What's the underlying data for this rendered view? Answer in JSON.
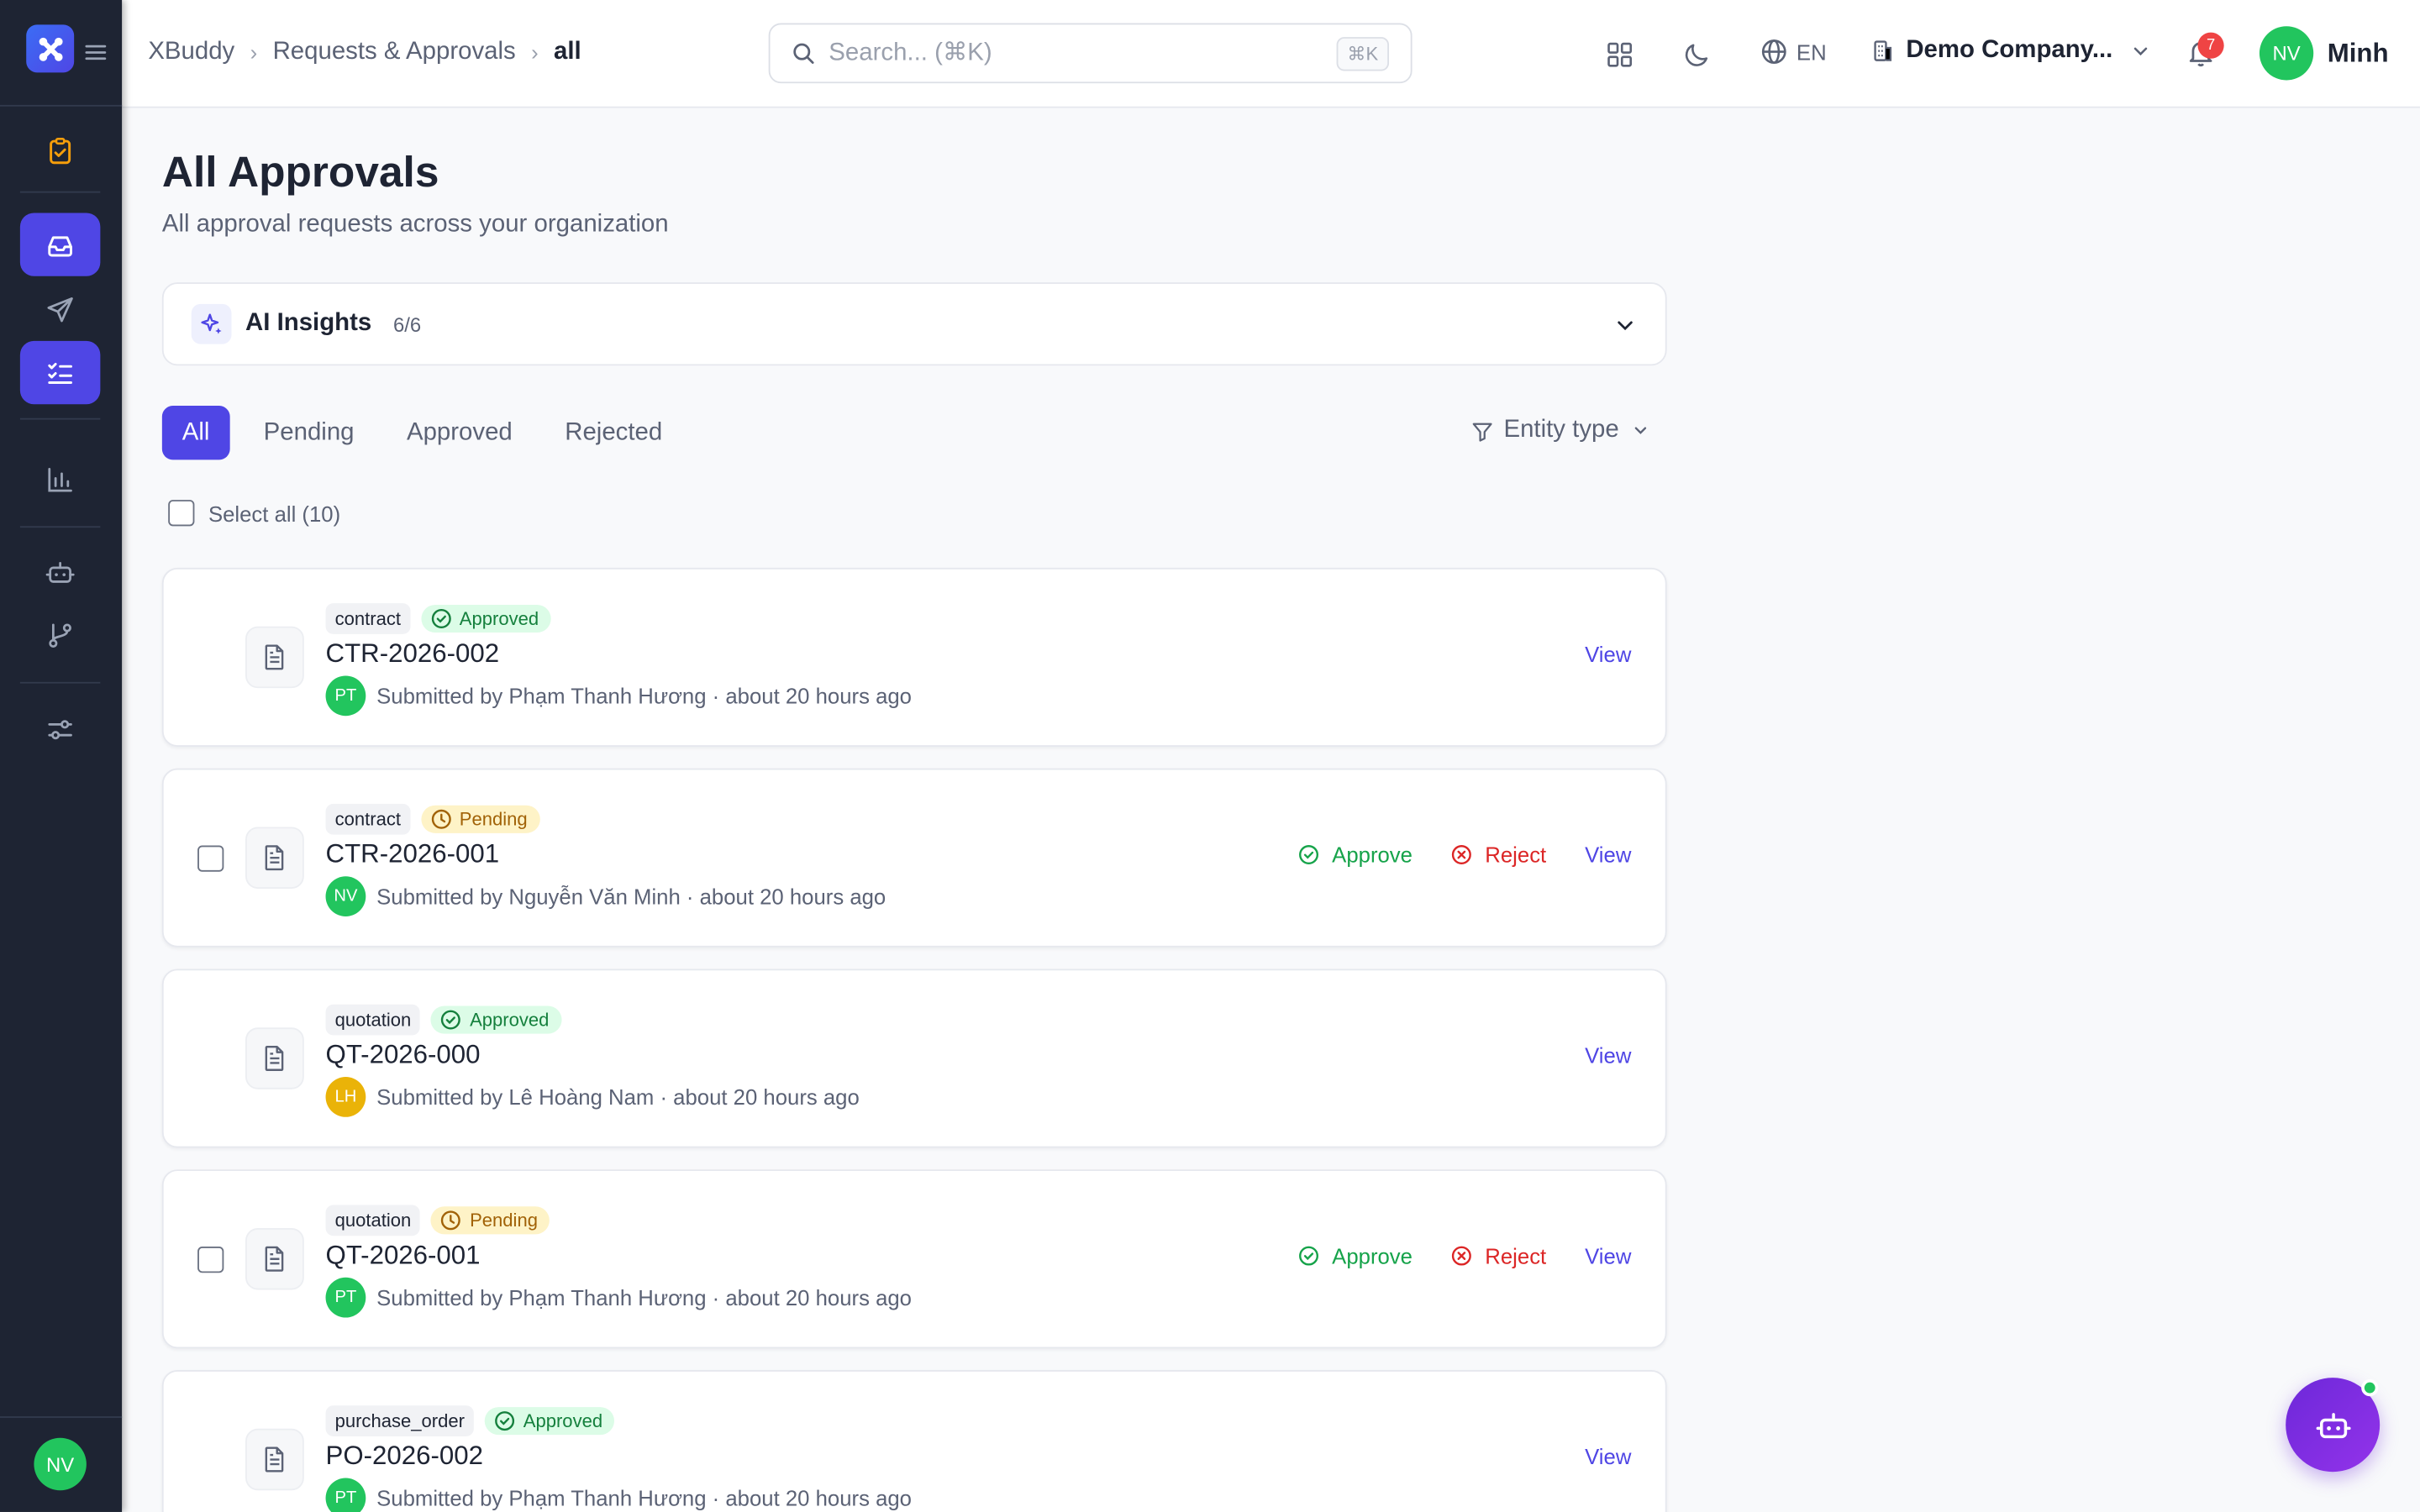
{
  "sidebar": {
    "avatar_initials": "NV"
  },
  "header": {
    "breadcrumb": [
      "XBuddy",
      "Requests & Approvals",
      "all"
    ],
    "search_placeholder": "Search... (⌘K)",
    "search_shortcut": "⌘K",
    "language": "EN",
    "company": "Demo Company...",
    "notification_count": "7",
    "user_initials": "NV",
    "user_name": "Minh"
  },
  "page": {
    "title": "All Approvals",
    "subtitle": "All approval requests across your organization"
  },
  "insights": {
    "title": "AI Insights",
    "count": "6/6"
  },
  "tabs": [
    {
      "label": "All",
      "active": true
    },
    {
      "label": "Pending",
      "active": false
    },
    {
      "label": "Approved",
      "active": false
    },
    {
      "label": "Rejected",
      "active": false
    }
  ],
  "filter_label": "Entity type",
  "select_all_label": "Select all (10)",
  "actions": {
    "approve": "Approve",
    "reject": "Reject",
    "view": "View"
  },
  "requests": [
    {
      "type": "contract",
      "status": "Approved",
      "code": "CTR-2026-002",
      "initials": "PT",
      "avatar_color": "#22c55e",
      "submitted": "Submitted by Phạm Thanh Hương · about 20 hours ago"
    },
    {
      "type": "contract",
      "status": "Pending",
      "code": "CTR-2026-001",
      "initials": "NV",
      "avatar_color": "#22c55e",
      "submitted": "Submitted by Nguyễn Văn Minh · about 20 hours ago"
    },
    {
      "type": "quotation",
      "status": "Approved",
      "code": "QT-2026-000",
      "initials": "LH",
      "avatar_color": "#eab308",
      "submitted": "Submitted by Lê Hoàng Nam · about 20 hours ago"
    },
    {
      "type": "quotation",
      "status": "Pending",
      "code": "QT-2026-001",
      "initials": "PT",
      "avatar_color": "#22c55e",
      "submitted": "Submitted by Phạm Thanh Hương · about 20 hours ago"
    },
    {
      "type": "purchase_order",
      "status": "Approved",
      "code": "PO-2026-002",
      "initials": "PT",
      "avatar_color": "#22c55e",
      "submitted": "Submitted by Phạm Thanh Hương · about 20 hours ago"
    }
  ],
  "colors": {
    "accent": "#4f46e5",
    "sidebar_bg": "#1e2433",
    "approved": "#16a34a",
    "pending": "#a16207",
    "reject": "#dc2626"
  }
}
